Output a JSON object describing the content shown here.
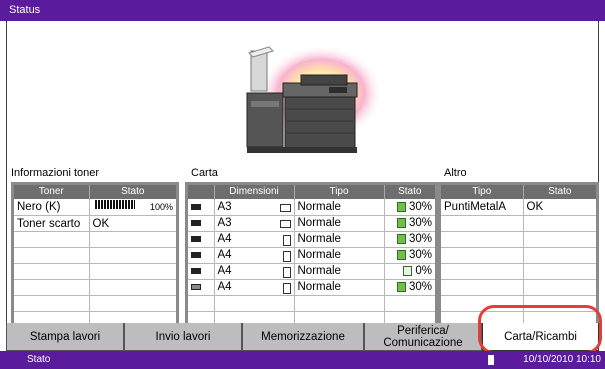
{
  "title": "Status",
  "toner": {
    "label": "Informazioni toner",
    "headers": [
      "Toner",
      "Stato"
    ],
    "rows": [
      {
        "name": "Nero (K)",
        "level_pct": "100%"
      },
      {
        "name": "Toner scarto",
        "status": "OK"
      }
    ]
  },
  "paper": {
    "label": "Carta",
    "headers": [
      "Dimensioni",
      "Tipo",
      "Stato"
    ],
    "rows": [
      {
        "size": "A3",
        "orient": "landscape",
        "type": "Normale",
        "level": "30%"
      },
      {
        "size": "A3",
        "orient": "landscape",
        "type": "Normale",
        "level": "30%"
      },
      {
        "size": "A4",
        "orient": "portrait",
        "type": "Normale",
        "level": "30%"
      },
      {
        "size": "A4",
        "orient": "portrait",
        "type": "Normale",
        "level": "30%"
      },
      {
        "size": "A4",
        "orient": "portrait",
        "type": "Normale",
        "level": "0%"
      },
      {
        "size": "A4",
        "orient": "portrait",
        "type": "Normale",
        "level": "30%"
      }
    ]
  },
  "other": {
    "label": "Altro",
    "headers": [
      "Tipo",
      "Stato"
    ],
    "rows": [
      {
        "type": "PuntiMetalA",
        "status": "OK"
      }
    ]
  },
  "tabs": [
    {
      "label": "Stampa lavori"
    },
    {
      "label": "Invio lavori"
    },
    {
      "label": "Memorizzazione"
    },
    {
      "label": "Periferica/\nComunicazione"
    },
    {
      "label": "Carta/Ricambi"
    }
  ],
  "statusbar": {
    "label": "Stato",
    "datetime": "10/10/2010  10:10"
  },
  "colors": {
    "accent": "#5a1b9c",
    "highlight": "#e0403a",
    "level": "#6fbf4a"
  }
}
